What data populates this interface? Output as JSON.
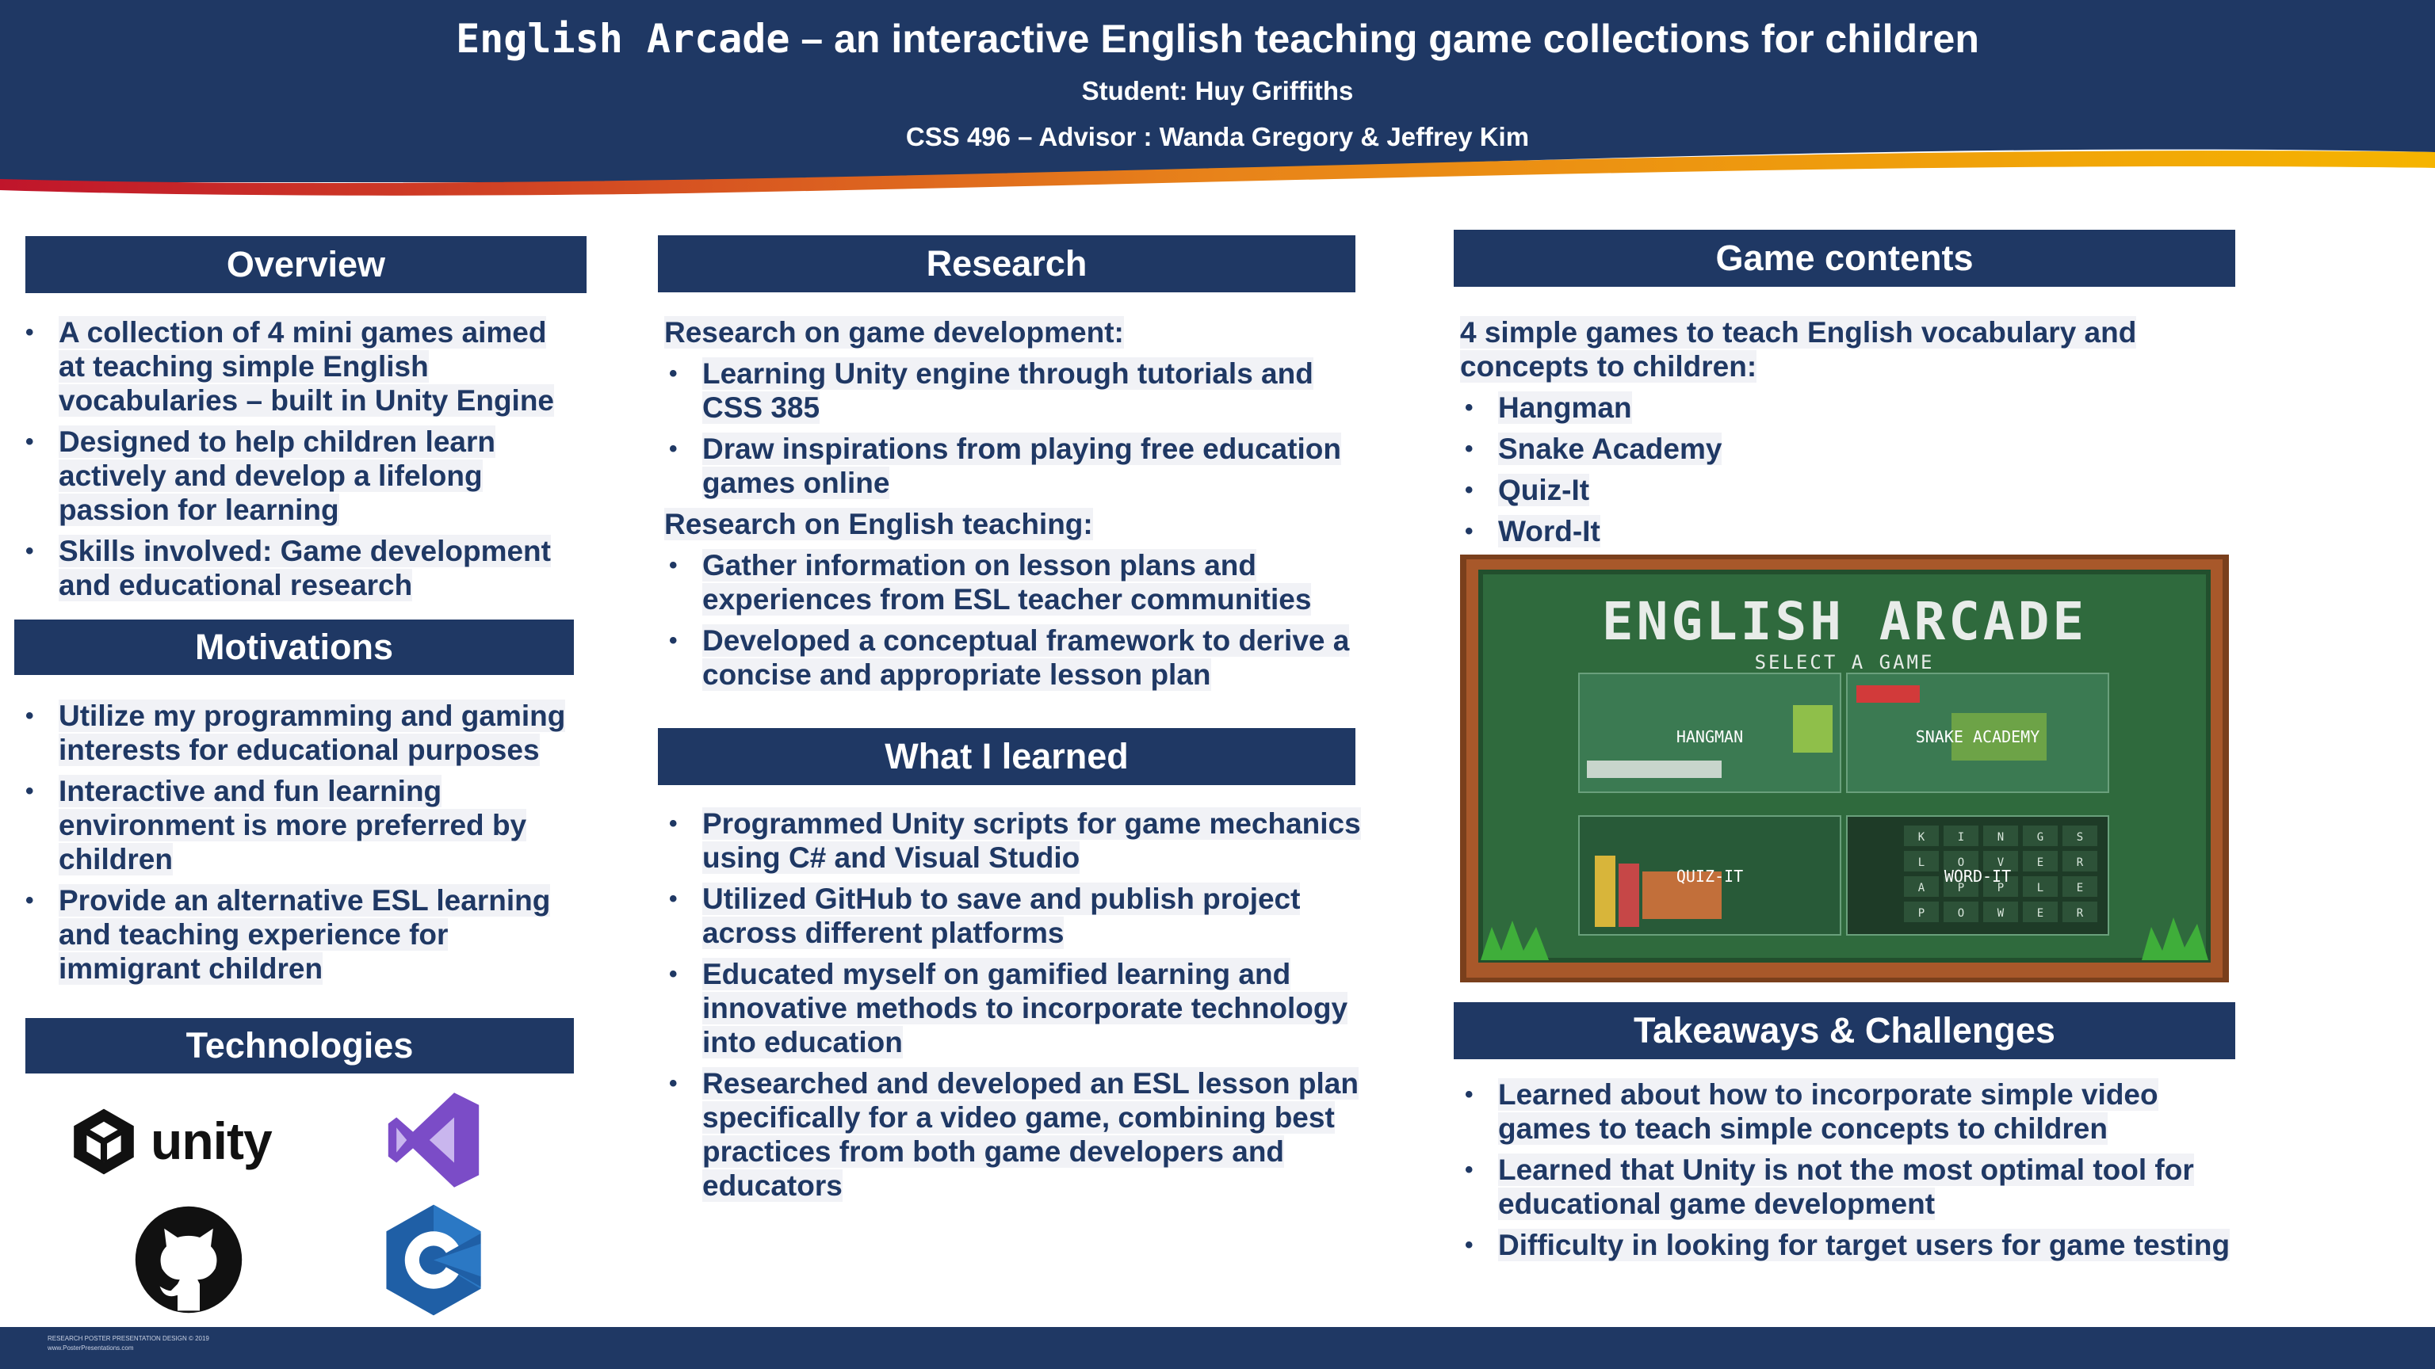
{
  "header": {
    "title_mono": "English Arcade",
    "title_rest": " – an interactive English teaching game collections for children",
    "student": "Student: Huy Griffiths",
    "advisor": "CSS 496 – Advisor : Wanda Gregory & Jeffrey Kim",
    "colors": {
      "navy": "#1f3864",
      "red": "#c0152b",
      "gold": "#f5b400"
    }
  },
  "overview": {
    "heading": "Overview",
    "items": [
      "A collection of 4 mini games aimed at teaching simple English vocabularies – built in Unity Engine",
      "Designed to help children learn actively and develop a lifelong passion for learning",
      "Skills involved: Game development and educational research"
    ]
  },
  "motivations": {
    "heading": "Motivations",
    "items": [
      "Utilize my programming and gaming interests for educational purposes",
      "Interactive and fun learning environment is more preferred by children",
      "Provide an alternative ESL learning and teaching experience for immigrant children"
    ]
  },
  "technologies": {
    "heading": "Technologies",
    "unity_label": "unity",
    "logos": [
      "unity-logo",
      "visual-studio-logo",
      "github-logo",
      "csharp-logo"
    ]
  },
  "research": {
    "heading": "Research",
    "intro1": "Research on game development:",
    "items1": [
      "Learning Unity engine through tutorials and CSS 385",
      "Draw inspirations from playing free education games online"
    ],
    "intro2": "Research on English teaching:",
    "items2": [
      "Gather information on lesson plans and experiences from ESL teacher communities",
      "Developed a conceptual framework to derive a concise and appropriate lesson plan"
    ]
  },
  "learned": {
    "heading": "What I learned",
    "items": [
      "Programmed Unity scripts for game mechanics using C# and Visual Studio",
      "Utilized GitHub to save and publish project across different platforms",
      "Educated myself on gamified learning and innovative methods to incorporate technology into education",
      "Researched and developed an ESL lesson plan specifically for a video game, combining best practices from both game developers and educators"
    ]
  },
  "game_contents": {
    "heading": "Game contents",
    "intro": "4 simple games to teach English vocabulary and concepts to children:",
    "items": [
      "Hangman",
      "Snake Academy",
      "Quiz-It",
      "Word-It"
    ]
  },
  "screenshot": {
    "title": "ENGLISH ARCADE",
    "subtitle": "SELECT A GAME",
    "tiles": [
      "HANGMAN",
      "SNAKE ACADEMY",
      "QUIZ-IT",
      "WORD-IT"
    ],
    "word_grid": [
      "K",
      "I",
      "N",
      "G",
      "S",
      "L",
      "O",
      "V",
      "E",
      "R",
      "A",
      "P",
      "P",
      "L",
      "E",
      "P",
      "O",
      "W",
      "E",
      "R"
    ]
  },
  "takeaways": {
    "heading": "Takeaways & Challenges",
    "items": [
      "Learned about how to incorporate simple video games to teach simple concepts to children",
      "Learned that Unity is not the most optimal tool for educational game development",
      "Difficulty in looking for target users for game testing"
    ]
  },
  "footer": {
    "fine1": "RESEARCH POSTER PRESENTATION DESIGN © 2019",
    "fine2": "www.PosterPresentations.com"
  }
}
